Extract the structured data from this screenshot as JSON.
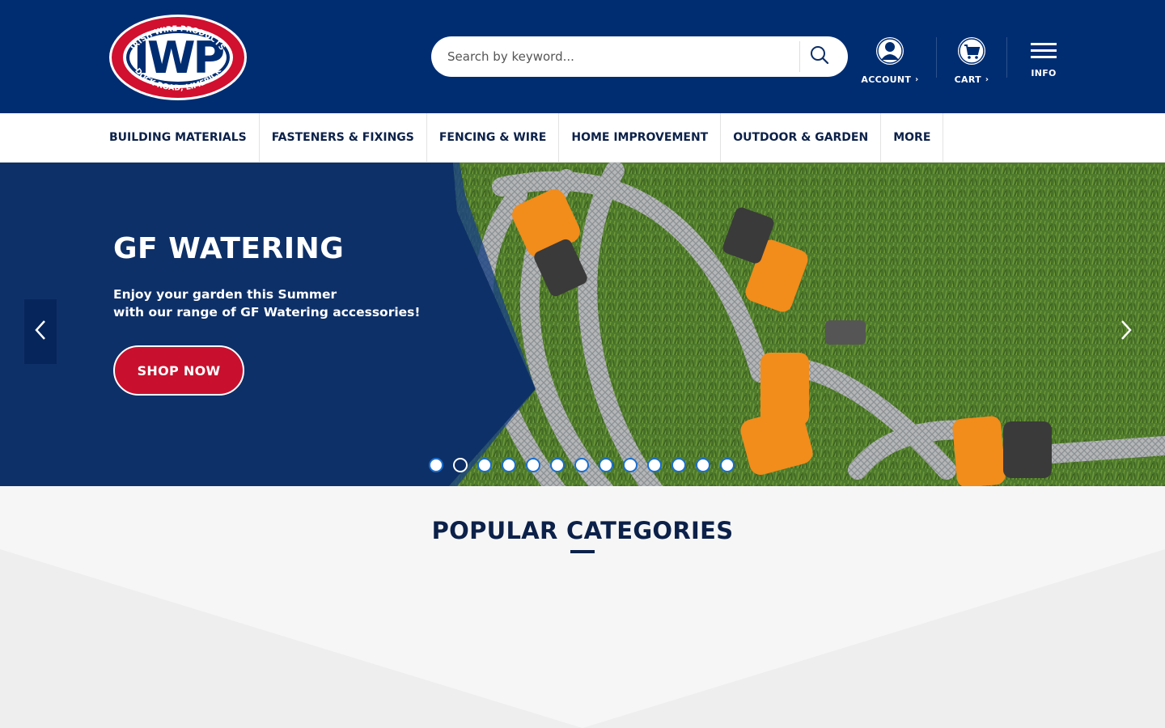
{
  "brand": {
    "logo_text": "IWP",
    "logo_top_text": "IRISH WIRE PRODUCTS",
    "logo_bottom_text": "DOCK ROAD, LIMERICK",
    "primary_color": "#002d72",
    "accent_color": "#c8102e"
  },
  "search": {
    "placeholder": "Search by keyword...",
    "icon": "search-icon"
  },
  "header": {
    "account_label": "ACCOUNT",
    "cart_label": "CART",
    "info_label": "INFO"
  },
  "nav": {
    "items": [
      {
        "label": "BUILDING MATERIALS"
      },
      {
        "label": "FASTENERS & FIXINGS"
      },
      {
        "label": "FENCING & WIRE"
      },
      {
        "label": "HOME IMPROVEMENT"
      },
      {
        "label": "OUTDOOR & GARDEN"
      },
      {
        "label": "MORE"
      }
    ]
  },
  "hero": {
    "title": "GF WATERING",
    "line1": "Enjoy your garden this Summer",
    "line2": "with our range of GF Watering accessories!",
    "cta": "SHOP NOW",
    "slide_count": 13,
    "active_slide": 2
  },
  "popular": {
    "title": "POPULAR CATEGORIES"
  }
}
